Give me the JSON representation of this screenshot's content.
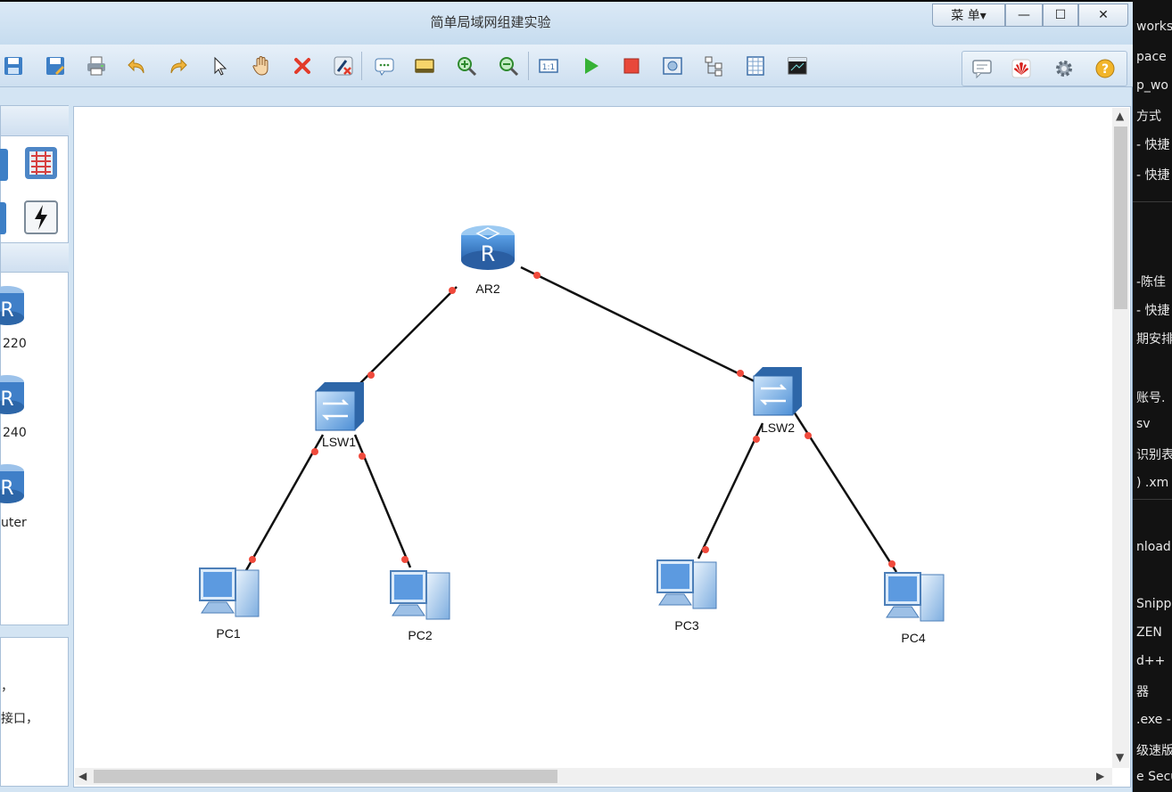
{
  "window": {
    "title": "简单局域网组建实验",
    "menu_label": "菜 单▾",
    "minimize": "—",
    "maximize": "☐",
    "close": "✕"
  },
  "toolbar": {
    "tools": [
      "save-icon",
      "save-as-icon",
      "print-icon",
      "undo-icon",
      "redo-icon",
      "select-icon",
      "pan-hand-icon",
      "delete-icon",
      "delete-link-icon",
      "text-note-icon",
      "palette-icon",
      "zoom-in-icon",
      "zoom-out-icon",
      "fit-icon",
      "start-icon",
      "stop-icon",
      "capture-icon",
      "topology-icon",
      "grid-icon",
      "terminal-icon"
    ],
    "right_tools": [
      "chat-icon",
      "huawei-logo-icon",
      "settings-icon",
      "help-icon"
    ]
  },
  "left_panel": {
    "devices": [
      {
        "label": "220"
      },
      {
        "label": "240"
      },
      {
        "label": "uter"
      }
    ],
    "description": [
      "，",
      "接口，"
    ]
  },
  "topology": {
    "nodes": [
      {
        "id": "AR2",
        "label": "AR2",
        "type": "router"
      },
      {
        "id": "LSW1",
        "label": "LSW1",
        "type": "switch"
      },
      {
        "id": "LSW2",
        "label": "LSW2",
        "type": "switch"
      },
      {
        "id": "PC1",
        "label": "PC1",
        "type": "pc"
      },
      {
        "id": "PC2",
        "label": "PC2",
        "type": "pc"
      },
      {
        "id": "PC3",
        "label": "PC3",
        "type": "pc"
      },
      {
        "id": "PC4",
        "label": "PC4",
        "type": "pc"
      }
    ],
    "links": [
      [
        "AR2",
        "LSW1"
      ],
      [
        "AR2",
        "LSW2"
      ],
      [
        "LSW1",
        "PC1"
      ],
      [
        "LSW1",
        "PC2"
      ],
      [
        "LSW2",
        "PC3"
      ],
      [
        "LSW2",
        "PC4"
      ]
    ],
    "port_color": "#f04a3c"
  },
  "background_window": {
    "lines": [
      "works",
      "pace",
      "p_wo",
      "方式",
      "- 快捷",
      "- 快捷",
      "-陈佳",
      "- 快捷",
      "期安排",
      "账号.",
      "sv",
      "识别表",
      ") .xm",
      "nload",
      "Snipp",
      "ZEN",
      "d++",
      "器",
      ".exe -",
      "级速版",
      "e Secu"
    ]
  }
}
